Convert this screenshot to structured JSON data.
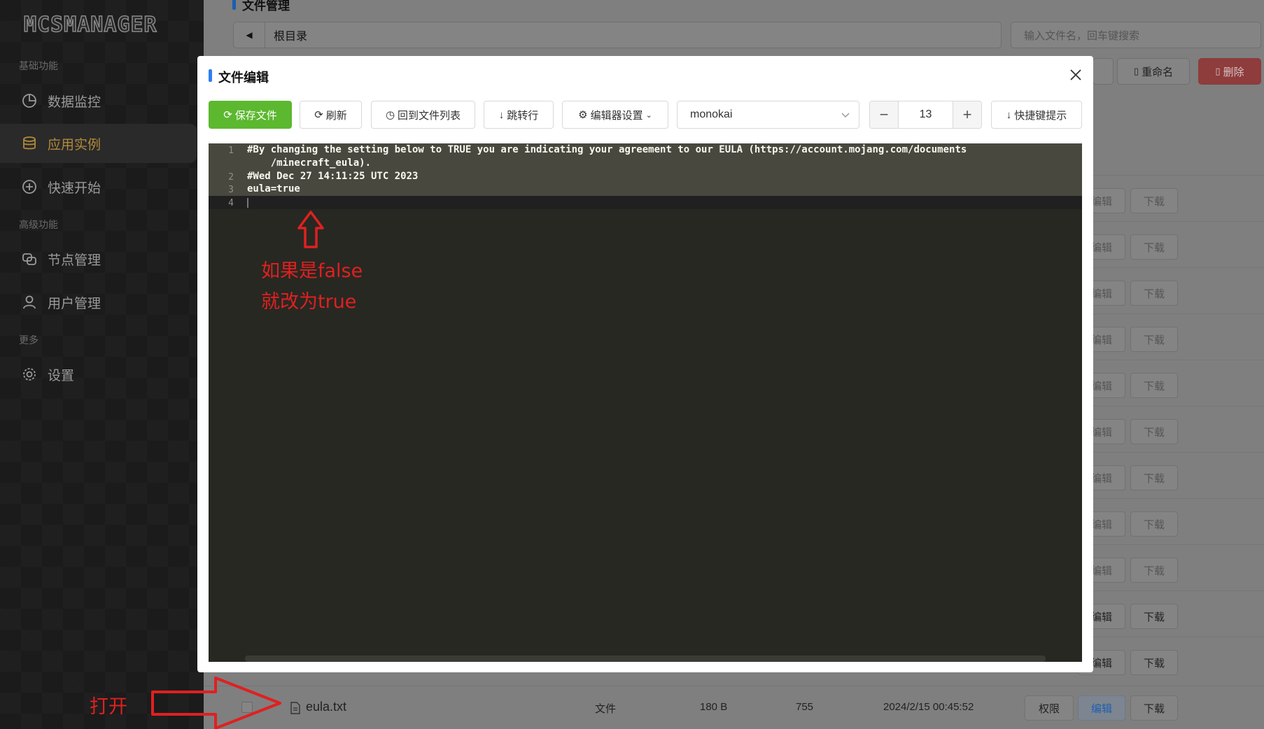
{
  "app": {
    "logo": "MCSMANAGER"
  },
  "sidebar": {
    "sections": [
      {
        "label": "基础功能"
      },
      {
        "label": "高级功能"
      },
      {
        "label": "更多"
      }
    ],
    "items": [
      {
        "label": "数据监控",
        "icon": "pie-chart-icon"
      },
      {
        "label": "应用实例",
        "icon": "database-icon"
      },
      {
        "label": "快速开始",
        "icon": "plus-circle-icon"
      },
      {
        "label": "节点管理",
        "icon": "nodes-icon"
      },
      {
        "label": "用户管理",
        "icon": "user-icon"
      },
      {
        "label": "设置",
        "icon": "gear-icon"
      }
    ]
  },
  "file_manager": {
    "title": "文件管理",
    "path": "根目录",
    "search_placeholder": "输入文件名，回车键搜索",
    "rename_label": "重命名",
    "delete_label": "删除",
    "row_actions": {
      "edit": "编辑",
      "download": "下载",
      "permission": "权限"
    },
    "eula_row": {
      "name": "eula.txt",
      "type": "文件",
      "size": "180 B",
      "permission": "755",
      "modified": "2024/2/15 00:45:52"
    }
  },
  "modal": {
    "title": "文件编辑",
    "toolbar": {
      "save": "保存文件",
      "refresh": "刷新",
      "back": "回到文件列表",
      "jump": "跳转行",
      "settings": "编辑器设置",
      "theme": "monokai",
      "font_size": "13",
      "shortcuts": "快捷键提示"
    },
    "editor": {
      "lines": [
        {
          "no": "1",
          "text": "#By changing the setting below to TRUE you are indicating your agreement to our EULA (https://account.mojang.com/documents"
        },
        {
          "no": "",
          "text": "    /minecraft_eula)."
        },
        {
          "no": "2",
          "text": "#Wed Dec 27 14:11:25 UTC 2023"
        },
        {
          "no": "3",
          "text": "eula=true"
        },
        {
          "no": "4",
          "text": ""
        }
      ]
    }
  },
  "annotations": {
    "open": "打开",
    "note_line1": "如果是false",
    "note_line2": "就改为true",
    "color": "#e02020"
  }
}
